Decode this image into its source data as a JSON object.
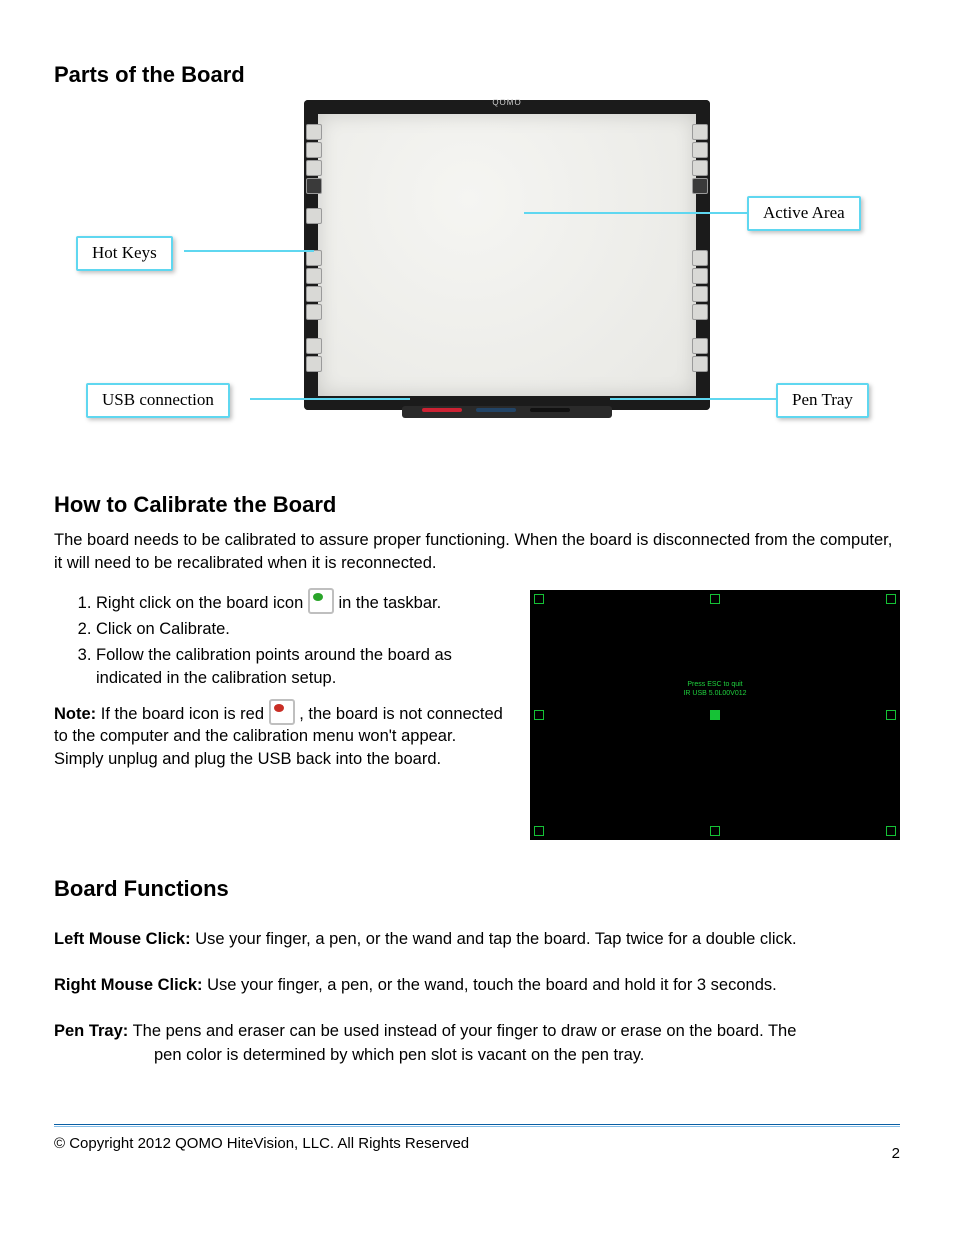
{
  "headings": {
    "parts": "Parts of the Board",
    "calibrate": "How to Calibrate the Board",
    "functions": "Board Functions"
  },
  "diagram": {
    "board_brand": "QOMO",
    "callouts": {
      "hot_keys": "Hot Keys",
      "usb": "USB connection",
      "active_area": "Active Area",
      "pen_tray": "Pen Tray"
    }
  },
  "calibrate": {
    "intro": "The board needs to be calibrated to assure proper functioning.   When the board is disconnected from the computer, it will need to be recalibrated when it is reconnected.",
    "steps": [
      "Right click on the board icon ",
      "Click on Calibrate.",
      "Follow the calibration points around the board as indicated in the calibration setup."
    ],
    "step1_tail": " in the taskbar.",
    "note_label": "Note:",
    "note_body_a": "  If the board icon is red ",
    "note_body_b": " , the board is not connected to the computer and the calibration menu won't appear.  Simply unplug and plug the USB back into the board.",
    "screen": {
      "line1": "Press ESC to quit",
      "line2": "IR USB 5.0L00V012"
    }
  },
  "functions": {
    "left_click": {
      "label": "Left Mouse Click:",
      "text": "  Use your finger, a pen, or the wand and tap the board.  Tap twice for a double click."
    },
    "right_click": {
      "label": "Right Mouse Click:",
      "text": "  Use your finger, a pen, or the wand, touch the board and hold it for 3 seconds."
    },
    "pen_tray": {
      "label": "Pen Tray:",
      "text_a": "   The pens and eraser can be used instead of your finger to draw or erase on the board.  The",
      "text_b": "pen color is determined by which pen slot is vacant on the pen tray."
    }
  },
  "footer": {
    "copyright": "© Copyright 2012 QOMO HiteVision, LLC. All Rights Reserved",
    "page": "2"
  }
}
